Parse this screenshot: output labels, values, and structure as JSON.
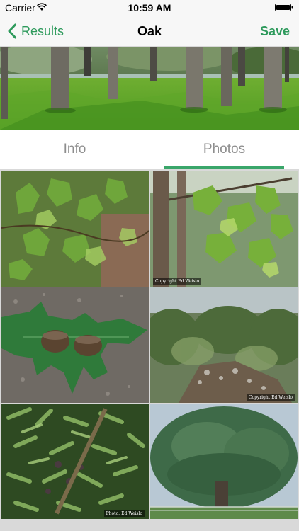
{
  "status_bar": {
    "carrier": "Carrier",
    "time": "10:59 AM",
    "wifi_icon": "wifi-icon",
    "battery_icon": "battery-icon"
  },
  "nav": {
    "back_label": "Results",
    "back_icon": "chevron-left-icon",
    "title": "Oak",
    "save_label": "Save",
    "accent_color": "#2e9a5c"
  },
  "tabs": [
    {
      "label": "Info",
      "selected": false
    },
    {
      "label": "Photos",
      "selected": true
    }
  ],
  "photos": [
    {
      "subject": "oak leaves on branch",
      "credit": ""
    },
    {
      "subject": "oak tree foliage and trunks",
      "credit": "Copyright Ed Weislo"
    },
    {
      "subject": "oak leaf with two acorns on gravel",
      "credit": ""
    },
    {
      "subject": "shrubby oak thicket",
      "credit": "Copyright Ed Weislo"
    },
    {
      "subject": "oak branch with leaves and acorns",
      "credit": "Photo: Ed Weislo"
    },
    {
      "subject": "large oak tree",
      "credit": ""
    }
  ]
}
